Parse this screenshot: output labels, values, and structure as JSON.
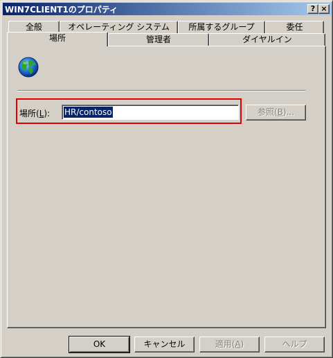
{
  "window": {
    "title": "WIN7CLIENT1のプロパティ",
    "help_button": "?",
    "close_button": "×"
  },
  "tabs": {
    "row_back": [
      "全般",
      "オペレーティング システム",
      "所属するグループ",
      "委任"
    ],
    "row_front": [
      "場所",
      "管理者",
      "ダイヤルイン"
    ],
    "active": "場所"
  },
  "location": {
    "label_prefix": "場所(",
    "label_key": "L",
    "label_suffix": "):",
    "value": "HR/contoso",
    "browse_prefix": "参照(",
    "browse_key": "B",
    "browse_suffix": ")..."
  },
  "buttons": {
    "ok": "OK",
    "cancel": "キャンセル",
    "apply_prefix": "適用(",
    "apply_key": "A",
    "apply_suffix": ")",
    "help": "ヘルプ"
  },
  "icons": {
    "location": "globe-icon"
  },
  "colors": {
    "titlebar_start": "#0a246a",
    "titlebar_end": "#a6caf0",
    "highlight": "#e00000",
    "selection": "#0a246a"
  }
}
